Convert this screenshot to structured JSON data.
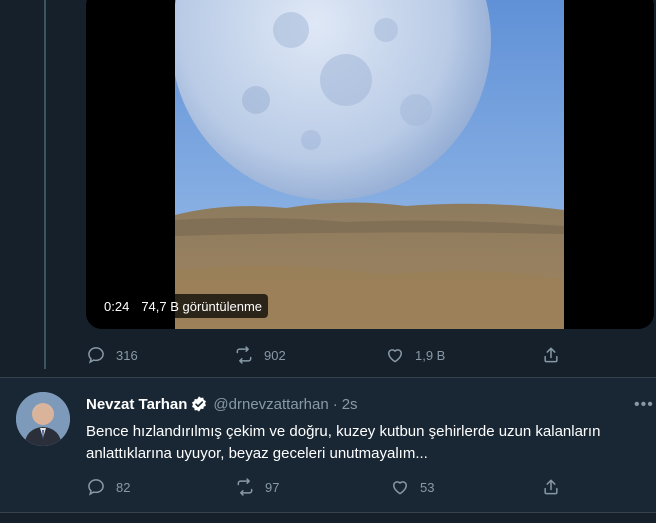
{
  "colors": {
    "background": "#15202b",
    "reply_background": "#192734",
    "muted": "#8899a6",
    "divider": "#38444d"
  },
  "video": {
    "duration": "0:24",
    "views": "74,7 B görüntülenme"
  },
  "top_tweet_actions": {
    "replies": "316",
    "retweets": "902",
    "likes": "1,9 B"
  },
  "reply_tweet": {
    "author_name": "Nevzat Tarhan",
    "handle": "@drnevzattarhan",
    "separator": "·",
    "time": "2s",
    "text": "Bence hızlandırılmış çekim ve doğru, kuzey kutbun şehirlerde  uzun kalanların anlattıklarına uyuyor, beyaz geceleri unutmayalım...",
    "more_label": "•••",
    "actions": {
      "replies": "82",
      "retweets": "97",
      "likes": "53"
    }
  },
  "icons": [
    "reply-icon",
    "retweet-icon",
    "like-icon",
    "share-icon",
    "verified-badge-icon",
    "more-icon"
  ]
}
